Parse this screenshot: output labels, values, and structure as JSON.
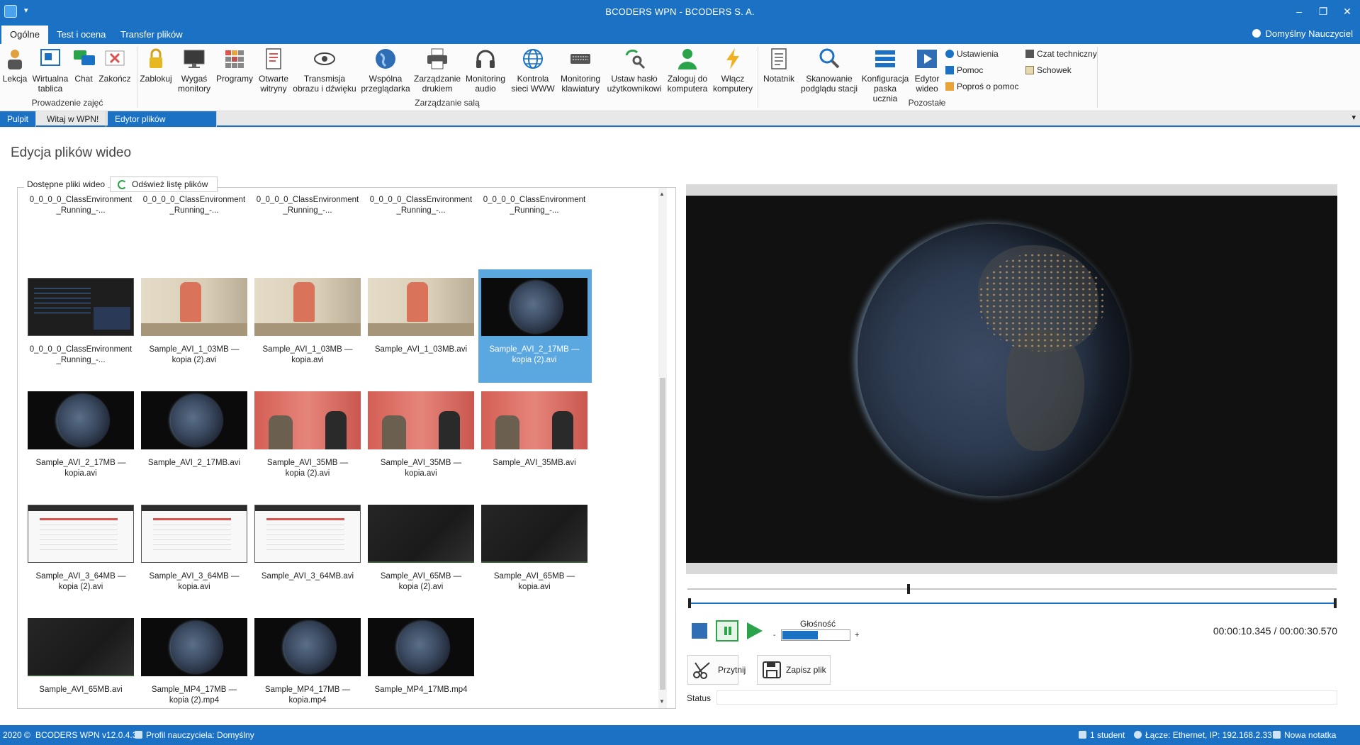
{
  "window": {
    "title": "BCODERS WPN - BCODERS S. A.",
    "controls": {
      "minimize": "–",
      "restore": "❐",
      "close": "✕"
    },
    "quick_access": "▾"
  },
  "ribbon_tabs": [
    {
      "label": "Ogólne",
      "active": true
    },
    {
      "label": "Test i ocena",
      "active": false
    },
    {
      "label": "Transfer plików",
      "active": false
    }
  ],
  "user": {
    "name": "Domyślny Nauczyciel"
  },
  "ribbon": {
    "groups": [
      {
        "label": "Prowadzenie zajęć",
        "buttons": [
          {
            "label": "Lekcja",
            "icon": "person-lesson-icon"
          },
          {
            "label": "Wirtualna\ntablica",
            "icon": "whiteboard-icon"
          },
          {
            "label": "Chat",
            "icon": "chat-icon"
          },
          {
            "label": "Zakończ",
            "icon": "end-session-icon"
          }
        ]
      },
      {
        "label": "Zarządzanie salą",
        "buttons": [
          {
            "label": "Zablokuj",
            "icon": "lock-icon"
          },
          {
            "label": "Wygaś\nmonitory",
            "icon": "monitor-off-icon"
          },
          {
            "label": "Programy",
            "icon": "programs-icon"
          },
          {
            "label": "Otwarte\nwitryny",
            "icon": "open-sites-icon"
          },
          {
            "label": "Transmisja\nobrazu i dźwięku",
            "icon": "broadcast-eye-icon"
          },
          {
            "label": "Wspólna\nprzeglądarka",
            "icon": "globe-icon"
          },
          {
            "label": "Zarządzanie\ndrukiem",
            "icon": "printer-icon"
          },
          {
            "label": "Monitoring\naudio",
            "icon": "headphones-icon"
          },
          {
            "label": "Kontrola\nsieci WWW",
            "icon": "web-control-icon"
          },
          {
            "label": "Monitoring\nklawiatury",
            "icon": "keyboard-icon"
          },
          {
            "label": "Ustaw hasło\nużytkownikowi",
            "icon": "password-key-icon"
          },
          {
            "label": "Zaloguj do\nkomputera",
            "icon": "login-user-icon"
          },
          {
            "label": "Włącz\nkomputery",
            "icon": "power-bolt-icon"
          }
        ]
      },
      {
        "label": "Pozostałe",
        "buttons": [
          {
            "label": "Notatnik",
            "icon": "notepad-icon"
          },
          {
            "label": "Skanowanie\npodglądu stacji",
            "icon": "scan-magnifier-icon"
          },
          {
            "label": "Konfiguracja\npaska ucznia",
            "icon": "toolbar-config-icon"
          },
          {
            "label": "Edytor\nwideo",
            "icon": "video-editor-icon"
          }
        ],
        "small_buttons": [
          {
            "label": "Ustawienia",
            "icon": "gear-icon"
          },
          {
            "label": "Pomoc",
            "icon": "help-icon"
          },
          {
            "label": "Poproś o pomoc",
            "icon": "ask-help-icon"
          },
          {
            "label": "Czat techniczny",
            "icon": "tech-chat-icon"
          },
          {
            "label": "Schowek",
            "icon": "clipboard-icon"
          }
        ]
      }
    ]
  },
  "doc_tabs": [
    {
      "label": "Pulpit"
    },
    {
      "label": "Witaj w WPN!"
    },
    {
      "label": "Edytor plików wideo",
      "close": "✕"
    }
  ],
  "doc_tabs_menu": "▾",
  "page": {
    "title": "Edycja plików wideo",
    "files_group_label": "Dostępne pliki wideo",
    "refresh_button": "Odśwież listę plików",
    "scroll_up": "▲",
    "scroll_down": "▼"
  },
  "files": [
    {
      "name": "0_0_0_0_ClassEnvironment\n_Running_-...",
      "thumb": "none"
    },
    {
      "name": "0_0_0_0_ClassEnvironment\n_Running_-...",
      "thumb": "none"
    },
    {
      "name": "0_0_0_0_ClassEnvironment\n_Running_-...",
      "thumb": "none"
    },
    {
      "name": "0_0_0_0_ClassEnvironment\n_Running_-...",
      "thumb": "none"
    },
    {
      "name": "0_0_0_0_ClassEnvironment\n_Running_-...",
      "thumb": "none"
    },
    {
      "name": "0_0_0_0_ClassEnvironment\n_Running_-...",
      "thumb": "code"
    },
    {
      "name": "Sample_AVI_1_03MB —\nkopia (2).avi",
      "thumb": "golf"
    },
    {
      "name": "Sample_AVI_1_03MB —\nkopia.avi",
      "thumb": "golf"
    },
    {
      "name": "Sample_AVI_1_03MB.avi",
      "thumb": "golf"
    },
    {
      "name": "Sample_AVI_2_17MB —\nkopia (2).avi",
      "thumb": "earth",
      "selected": true
    },
    {
      "name": "Sample_AVI_2_17MB —\nkopia.avi",
      "thumb": "earth"
    },
    {
      "name": "Sample_AVI_2_17MB.avi",
      "thumb": "earth"
    },
    {
      "name": "Sample_AVI_35MB —\nkopia (2).avi",
      "thumb": "talk"
    },
    {
      "name": "Sample_AVI_35MB —\nkopia.avi",
      "thumb": "talk"
    },
    {
      "name": "Sample_AVI_35MB.avi",
      "thumb": "talk"
    },
    {
      "name": "Sample_AVI_3_64MB —\nkopia (2).avi",
      "thumb": "web"
    },
    {
      "name": "Sample_AVI_3_64MB —\nkopia.avi",
      "thumb": "web"
    },
    {
      "name": "Sample_AVI_3_64MB.avi",
      "thumb": "web"
    },
    {
      "name": "Sample_AVI_65MB —\nkopia (2).avi",
      "thumb": "dark"
    },
    {
      "name": "Sample_AVI_65MB —\nkopia.avi",
      "thumb": "dark"
    },
    {
      "name": "Sample_AVI_65MB.avi",
      "thumb": "dark"
    },
    {
      "name": "Sample_MP4_17MB —\nkopia (2).mp4",
      "thumb": "earth"
    },
    {
      "name": "Sample_MP4_17MB —\nkopia.mp4",
      "thumb": "earth"
    },
    {
      "name": "Sample_MP4_17MB.mp4",
      "thumb": "earth"
    }
  ],
  "player": {
    "volume_label": "Głośność",
    "volume_minus": "-",
    "volume_plus": "+",
    "volume_level": 0.52,
    "playback_position": 0.34,
    "time_current": "00:00:10.345",
    "time_total": "00:00:30.570",
    "time_separator": " / ",
    "cut_button": "Przytnij",
    "save_button": "Zapisz plik",
    "status_label": "Status",
    "status_value": ""
  },
  "statusbar": {
    "copyright": "2020 ©",
    "version": "BCODERS WPN v12.0.4.3",
    "profile": "Profil nauczyciela: Domyślny",
    "students": "1 student",
    "connection": "Łącze: Ethernet, IP: 192.168.2.33",
    "note": "Nowa notatka"
  },
  "colors": {
    "accent": "#1b72c4",
    "selected_tile": "#5ba7e0",
    "play_green": "#2aa34a"
  }
}
